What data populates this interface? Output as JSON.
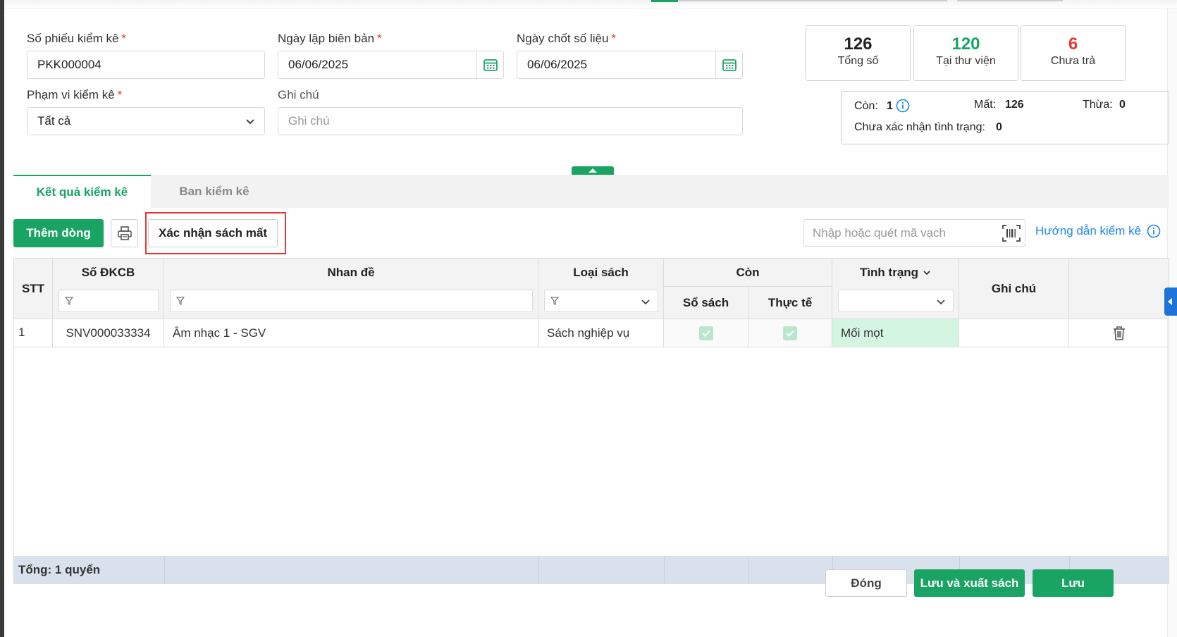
{
  "form": {
    "doc_number_label": "Số phiếu kiểm kê",
    "doc_number_value": "PKK000004",
    "created_date_label": "Ngày lập biên bản",
    "created_date_value": "06/06/2025",
    "cutoff_date_label": "Ngày chốt số liệu",
    "cutoff_date_value": "06/06/2025",
    "scope_label": "Phạm vi kiểm kê",
    "scope_value": "Tất cả",
    "note_label": "Ghi chú",
    "note_placeholder": "Ghi chú",
    "required_mark": "*"
  },
  "stats": {
    "total": {
      "value": "126",
      "label": "Tổng số",
      "color": "#111111"
    },
    "in_library": {
      "value": "120",
      "label": "Tại thư viện",
      "color": "#19a463"
    },
    "not_returned": {
      "value": "6",
      "label": "Chưa trả",
      "color": "#e53935"
    }
  },
  "summary": {
    "remaining_label": "Còn:",
    "remaining_value": "1",
    "lost_label": "Mất:",
    "lost_value": "126",
    "surplus_label": "Thừa:",
    "surplus_value": "0",
    "unconfirmed_label": "Chưa xác nhận tình trạng:",
    "unconfirmed_value": "0"
  },
  "tabs": [
    {
      "label": "Kết quả kiểm kê",
      "active": true
    },
    {
      "label": "Ban kiểm kê",
      "active": false
    }
  ],
  "toolbar": {
    "add_row_label": "Thêm dòng",
    "confirm_lost_label": "Xác nhận sách mất",
    "barcode_placeholder": "Nhập hoặc quét mã vạch",
    "guide_label": "Hướng dẫn kiểm kê"
  },
  "table": {
    "headers": {
      "stt": "STT",
      "code": "Số ĐKCB",
      "title": "Nhan đề",
      "type": "Loại sách",
      "remaining": "Còn",
      "remaining_books": "Sổ sách",
      "remaining_actual": "Thực tế",
      "status": "Tình trạng",
      "note": "Ghi chú"
    },
    "rows": [
      {
        "stt": "1",
        "code": "SNV000033334",
        "title": "Âm nhạc 1 - SGV",
        "type": "Sách nghiệp vụ",
        "books_checked": true,
        "actual_checked": true,
        "status": "Mối mọt",
        "note": ""
      }
    ],
    "footer": "Tổng: 1 quyển"
  },
  "actions": {
    "close_label": "Đóng",
    "save_export_label": "Lưu và xuất sách",
    "save_label": "Lưu"
  },
  "colors": {
    "accent": "#19a463",
    "danger": "#e53935",
    "link": "#1e88e5",
    "status_bg": "#d4f5e2"
  }
}
